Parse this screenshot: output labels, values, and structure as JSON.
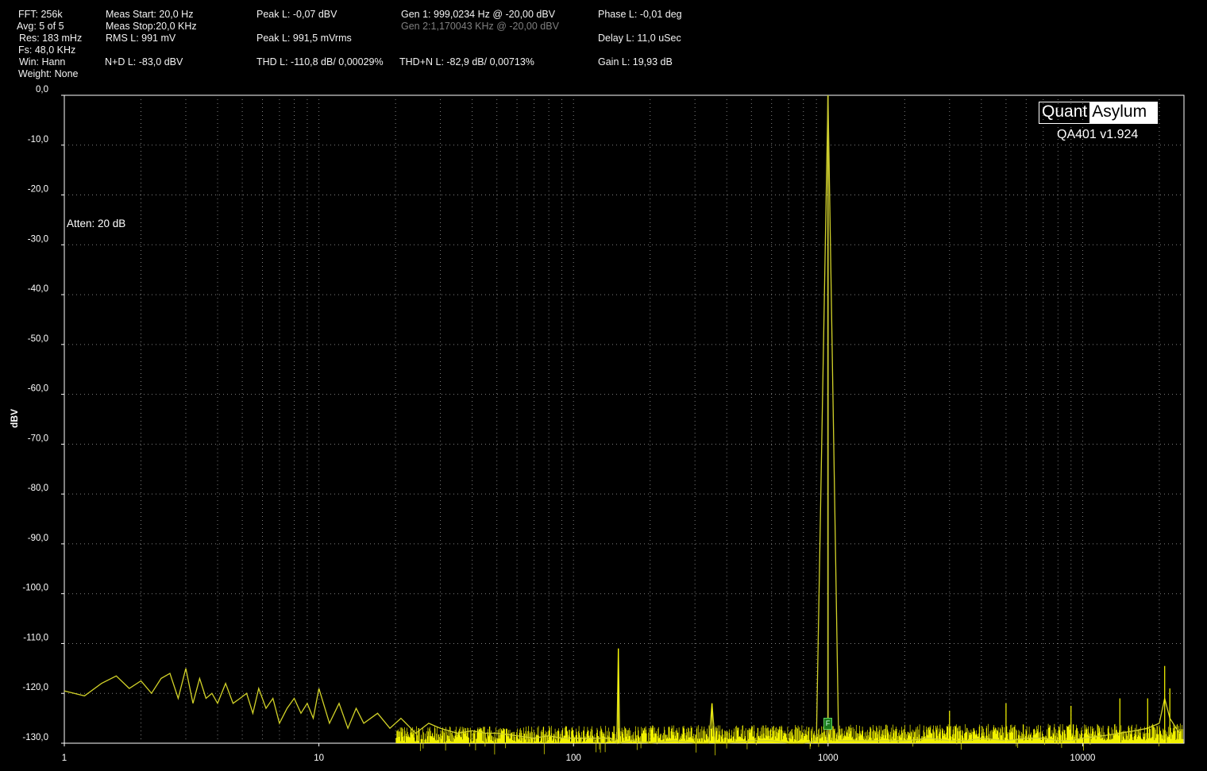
{
  "stats": {
    "fft": "FFT: 256k",
    "avg": "Avg: 5 of 5",
    "res": "Res: 183 mHz",
    "fs": "Fs: 48,0 KHz",
    "win": "Win: Hann",
    "weight": "Weight: None",
    "meas_start": "Meas Start: 20,0 Hz",
    "meas_stop": "Meas Stop:20,0 KHz",
    "rms": "RMS L: 991 mV",
    "nd": "N+D L: -83,0 dBV",
    "peak_dbv": "Peak L: -0,07 dBV",
    "peak_mv": "Peak L: 991,5 mVrms",
    "thd": "THD L: -110,8 dB/ 0,00029%",
    "gen1": "Gen 1: 999,0234 Hz @ -20,00  dBV",
    "gen2": "Gen 2:1,170043 KHz @ -20,00  dBV",
    "thdn": "THD+N L: -82,9 dB/ 0,00713%",
    "phase": "Phase L: -0,01 deg",
    "delay": "Delay L: 11,0 uSec",
    "gain": "Gain L: 19,93 dB"
  },
  "logo": {
    "left": "Quant",
    "right": "Asylum",
    "version": "QA401 v1.924"
  },
  "annotation": "Atten: 20 dB",
  "marker_label": "F",
  "colors": {
    "trace": "#ffff00",
    "fundamental": "#c8c832",
    "grid": "#808080",
    "marker": "#1a7a1a"
  },
  "chart_data": {
    "type": "line",
    "xscale": "log",
    "xlim": [
      1,
      25000
    ],
    "ylim": [
      -130,
      0
    ],
    "ylabel": "dBV",
    "yticks": [
      0,
      -10,
      -20,
      -30,
      -40,
      -50,
      -60,
      -70,
      -80,
      -90,
      -100,
      -110,
      -120,
      -130
    ],
    "ytick_labels": [
      "0,0",
      "-10,0",
      "-20,0",
      "-30,0",
      "-40,0",
      "-50,0",
      "-60,0",
      "-70,0",
      "-80,0",
      "-90,0",
      "-100,0",
      "-110,0",
      "-120,0",
      "-130,0"
    ],
    "xticks": [
      1,
      10,
      100,
      1000,
      10000
    ],
    "xtick_labels": [
      "1",
      "10",
      "100",
      "1000",
      "10000"
    ],
    "grid": true,
    "series": [
      {
        "x": [
          1,
          1.2,
          1.4,
          1.6,
          1.8,
          2.0,
          2.2,
          2.4,
          2.6,
          2.8,
          3.0,
          3.2,
          3.4,
          3.6,
          3.8,
          4.0,
          4.3,
          4.6,
          4.9,
          5.2,
          5.5,
          5.8,
          6.2,
          6.6,
          7.0,
          7.5,
          8.0,
          8.5,
          9.0,
          9.5,
          10,
          11,
          12,
          13,
          14,
          15,
          17,
          19,
          21,
          24,
          27,
          30,
          35,
          40,
          45,
          50,
          60,
          70,
          80,
          90,
          100,
          120,
          140,
          148,
          150,
          152,
          170,
          200,
          250,
          300,
          340,
          350,
          360,
          400,
          500,
          600,
          700,
          800,
          900,
          999,
          1100,
          1300,
          1600,
          2000,
          2500,
          3000,
          3500,
          4000,
          5000,
          6000,
          7000,
          8000,
          9000,
          10000,
          12000,
          14000,
          16000,
          18000,
          20000,
          21000,
          22000,
          24000
        ],
        "y": [
          -119.5,
          -120.5,
          -118,
          -116.5,
          -119,
          -117.5,
          -120,
          -117,
          -116,
          -121,
          -115,
          -122,
          -117,
          -121,
          -120,
          -122,
          -118,
          -122,
          -121,
          -120,
          -124,
          -119,
          -123,
          -121,
          -126,
          -123,
          -121,
          -124,
          -122,
          -125,
          -119,
          -126,
          -122,
          -127,
          -123,
          -126,
          -124,
          -127,
          -125,
          -128,
          -126,
          -127,
          -128,
          -127.5,
          -128,
          -128,
          -128.5,
          -129,
          -128.5,
          -129,
          -129,
          -129,
          -129,
          -130,
          -111,
          -130,
          -129.5,
          -130,
          -129.5,
          -130,
          -130,
          -122,
          -130,
          -130,
          -129.5,
          -129.5,
          -130,
          -130,
          -129.5,
          0,
          -129.5,
          -129.5,
          -129.5,
          -129.5,
          -129,
          -129.5,
          -129.5,
          -129,
          -129.5,
          -129,
          -129,
          -129.5,
          -129.5,
          -129,
          -128.5,
          -128,
          -127.5,
          -127,
          -126,
          -121,
          -125,
          -128
        ]
      }
    ],
    "fundamental_hz": 999.0234,
    "spurs": [
      {
        "x": 150,
        "y": -111
      },
      {
        "x": 350,
        "y": -122
      },
      {
        "x": 3000,
        "y": -123.5
      },
      {
        "x": 5000,
        "y": -122
      },
      {
        "x": 9000,
        "y": -122.5
      },
      {
        "x": 14000,
        "y": -121
      },
      {
        "x": 18000,
        "y": -121
      },
      {
        "x": 21000,
        "y": -114.5
      },
      {
        "x": 22000,
        "y": -119
      }
    ]
  }
}
